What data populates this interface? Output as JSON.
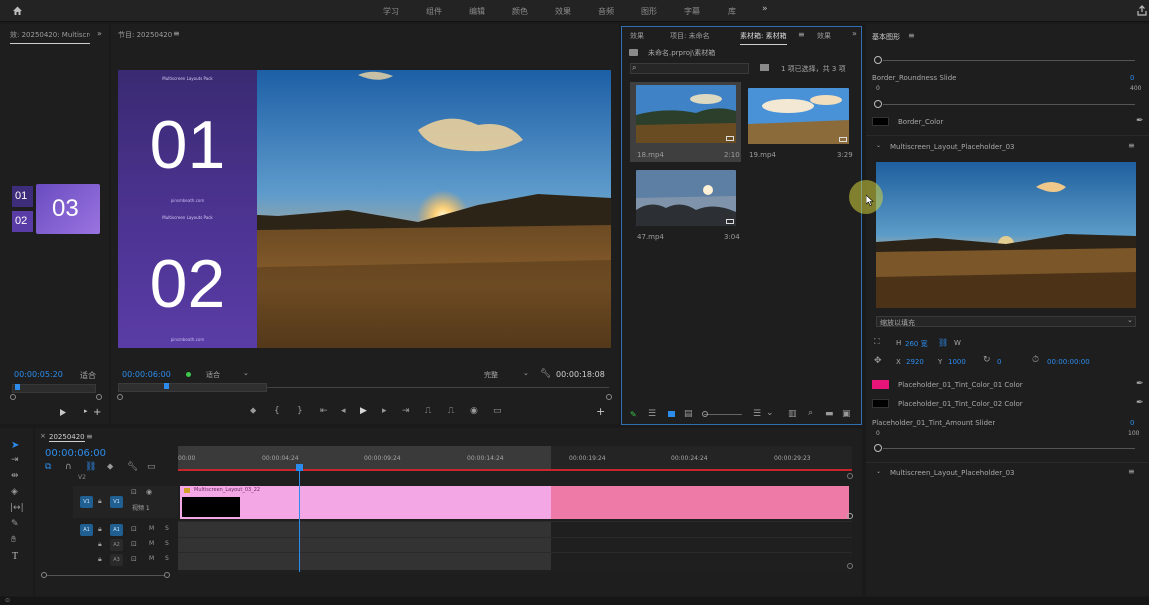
{
  "workspace_tabs": [
    "学习",
    "组件",
    "编辑",
    "颜色",
    "效果",
    "音频",
    "图形",
    "字幕",
    "库"
  ],
  "source_panel": {
    "title": "效: 20250420: Multiscre",
    "card_numbers": [
      "01",
      "02",
      "03"
    ],
    "timecode": "00:00:05:20",
    "fit_label": "适合"
  },
  "program": {
    "title": "节目: 20250420",
    "card_caption": "Multiscreen Layouts Pack",
    "card_footer": "pinsmbeath.com",
    "card_numbers": [
      "01",
      "02"
    ],
    "timecode": "00:00:06:00",
    "fit_label": "适合",
    "quality": "完整",
    "duration": "00:00:18:08"
  },
  "project_panel": {
    "tabs": [
      "效果",
      "项目: 未命名",
      "素材箱: 素材箱",
      "效果"
    ],
    "bin_path": "未命名.prproj\\素材箱",
    "search_placeholder": "",
    "selection_info": "1 项已选择，共 3 项",
    "clips": [
      {
        "name": "18.mp4",
        "duration": "2:10"
      },
      {
        "name": "19.mp4",
        "duration": "3:29"
      },
      {
        "name": "47.mp4",
        "duration": "3:04"
      }
    ]
  },
  "essential_graphics": {
    "title": "基本图形",
    "border_roundness_label": "Border_Roundness Slide",
    "border_roundness_value": "0",
    "border_roundness_min": "0",
    "border_roundness_max": "400",
    "border_color_label": "Border_Color",
    "group_label": "Multiscreen_Layout_Placeholder_03",
    "scale_mode": "缩放以填充",
    "height": "260 宽",
    "width_label": "W",
    "pos_x_label": "X",
    "pos_x": "2920",
    "pos_y_label": "Y",
    "pos_y": "1000",
    "rotation": "0",
    "time": "00:00:00:00",
    "tint1_label": "Placeholder_01_Tint_Color_01 Color",
    "tint1_color": "#e8147a",
    "tint2_label": "Placeholder_01_Tint_Color_02 Color",
    "tint2_color": "#000000",
    "tint_amount_label": "Placeholder_01_Tint_Amount Slider",
    "tint_amount_value": "0",
    "tint_amount_min": "0",
    "tint_amount_max": "100",
    "next_group_label": "Multiscreen_Layout_Placeholder_03"
  },
  "timeline": {
    "sequence_name": "20250420",
    "timecode": "00:00:06:00",
    "ruler": [
      "00:00",
      "00:00:04:24",
      "00:00:09:24",
      "00:00:14:24",
      "00:00:19:24",
      "00:00:24:24",
      "00:00:29:23"
    ],
    "clip_name": "Multiscreen_Layout_03_22",
    "video_track_name": "视频 1",
    "tracks": [
      "V1",
      "A1",
      "A2",
      "A3"
    ]
  }
}
